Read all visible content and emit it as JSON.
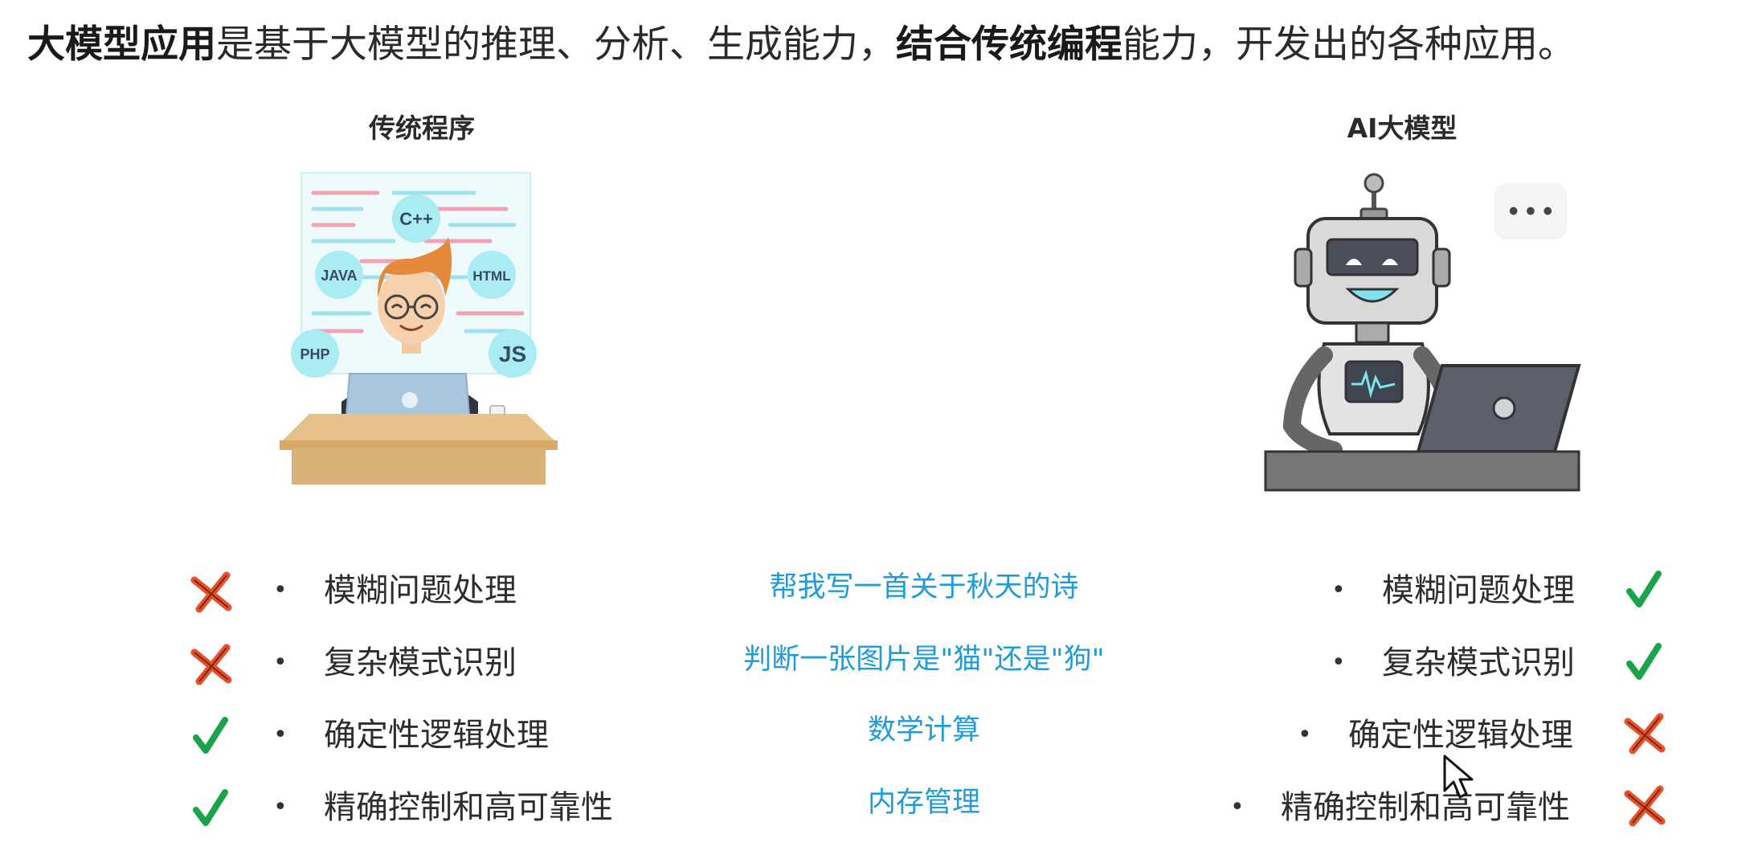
{
  "intro": {
    "bold1": "大模型应用",
    "text1": "是基于大模型的推理、分析、生成能力，",
    "bold2": "结合传统编程",
    "text2": "能力，开发出的各种应用。"
  },
  "left": {
    "heading": "传统程序",
    "illustration": {
      "bubbles": [
        "C++",
        "JAVA",
        "HTML",
        "PHP",
        "JS"
      ]
    },
    "items": [
      {
        "label": "模糊问题处理",
        "status": "cross"
      },
      {
        "label": "复杂模式识别",
        "status": "cross"
      },
      {
        "label": "确定性逻辑处理",
        "status": "check"
      },
      {
        "label": "精确控制和高可靠性",
        "status": "check"
      }
    ]
  },
  "right": {
    "heading": "AI大模型",
    "illustration": {
      "speech": "• • •"
    },
    "items": [
      {
        "label": "模糊问题处理",
        "status": "check"
      },
      {
        "label": "复杂模式识别",
        "status": "check"
      },
      {
        "label": "确定性逻辑处理",
        "status": "cross"
      },
      {
        "label": "精确控制和高可靠性",
        "status": "cross"
      }
    ]
  },
  "examples": [
    "帮我写一首关于秋天的诗",
    "判断一张图片是\"猫\"还是\"狗\"",
    "数学计算",
    "内存管理"
  ],
  "bullet_char": "•",
  "colors": {
    "check": "#1aa34a",
    "cross": "#e8502a",
    "example": "#1e9bd8"
  }
}
